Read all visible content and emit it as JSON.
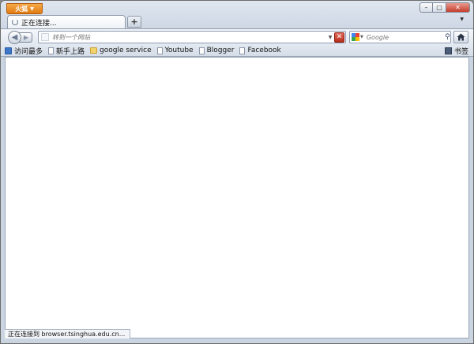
{
  "app_menu": {
    "label": "火狐"
  },
  "window_controls": {
    "minimize": "–",
    "maximize": "▢",
    "close": "✕"
  },
  "tabs": [
    {
      "title": "正在连接..."
    }
  ],
  "new_tab_label": "+",
  "nav": {
    "url_placeholder": "转到一个网站",
    "search_placeholder": "Google",
    "search_engine": "Google"
  },
  "bookmarks": {
    "items": [
      {
        "label": "访问最多",
        "icon": "smart-bookmark-icon"
      },
      {
        "label": "新手上路",
        "icon": "page-icon"
      },
      {
        "label": "google service",
        "icon": "folder-icon"
      },
      {
        "label": "Youtube",
        "icon": "page-icon"
      },
      {
        "label": "Blogger",
        "icon": "page-icon"
      },
      {
        "label": "Facebook",
        "icon": "page-icon"
      }
    ],
    "menu_label": "书签"
  },
  "status": {
    "text": "正在连接到 browser.tsinghua.edu.cn..."
  },
  "colors": {
    "accent": "#e07a10",
    "chrome": "#cbd5e2",
    "stop": "#c53d2a"
  }
}
